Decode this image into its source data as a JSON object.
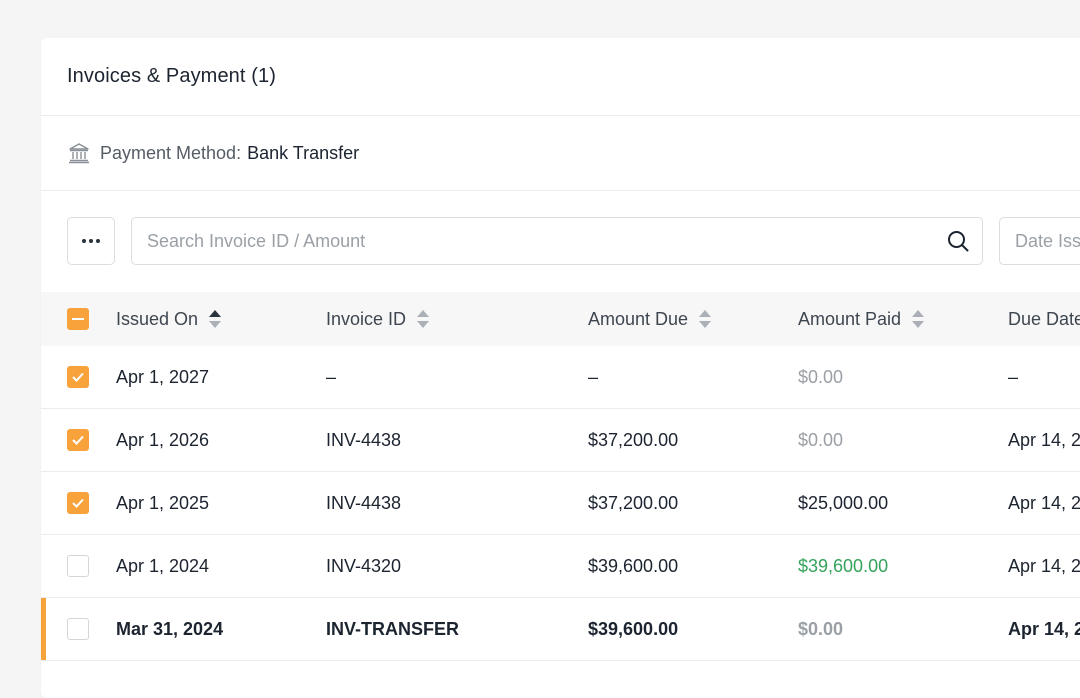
{
  "card": {
    "title": "Invoices & Payment (1)"
  },
  "payment_method": {
    "label": "Payment Method:",
    "value": "Bank Transfer",
    "icon": "bank-icon"
  },
  "toolbar": {
    "more_icon": "ellipsis-icon",
    "search_placeholder": "Search Invoice ID / Amount",
    "search_icon": "search-icon",
    "date_placeholder": "Date Iss"
  },
  "colors": {
    "accent": "#f7a23b",
    "paid_full": "#35a35b",
    "muted": "#9aa0a6"
  },
  "table": {
    "headers": {
      "issued_on": "Issued On",
      "invoice_id": "Invoice ID",
      "amount_due": "Amount Due",
      "amount_paid": "Amount Paid",
      "due_date": "Due Date"
    },
    "sort": {
      "issued_on": "ascending",
      "invoice_id": "none",
      "amount_due": "none",
      "amount_paid": "none"
    },
    "rows": [
      {
        "checked": true,
        "issued_on": "Apr 1, 2027",
        "invoice_id": "–",
        "amount_due": "–",
        "amount_paid": "$0.00",
        "due_date": "–"
      },
      {
        "checked": true,
        "issued_on": "Apr 1, 2026",
        "invoice_id": "INV-4438",
        "amount_due": "$37,200.00",
        "amount_paid": "$0.00",
        "due_date": "Apr 14, 2"
      },
      {
        "checked": true,
        "issued_on": "Apr 1, 2025",
        "invoice_id": "INV-4438",
        "amount_due": "$37,200.00",
        "amount_paid": "$25,000.00",
        "due_date": "Apr 14, 2"
      },
      {
        "checked": false,
        "issued_on": "Apr 1, 2024",
        "invoice_id": "INV-4320",
        "amount_due": "$39,600.00",
        "amount_paid": "$39,600.00",
        "due_date": "Apr 14, 2"
      },
      {
        "checked": false,
        "issued_on": "Mar 31, 2024",
        "invoice_id": "INV-TRANSFER",
        "amount_due": "$39,600.00",
        "amount_paid": "$0.00",
        "due_date": "Apr 14, 2"
      }
    ]
  }
}
